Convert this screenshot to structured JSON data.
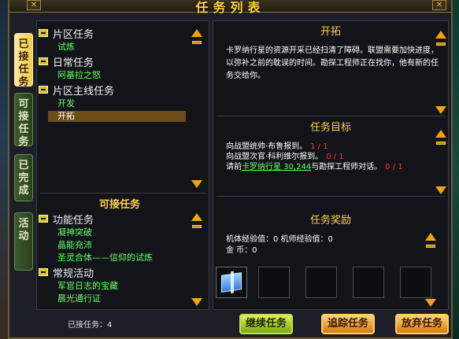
{
  "window": {
    "title": "任务列表",
    "left_button": "✕",
    "close_button": "✕"
  },
  "side_tabs": [
    {
      "label": "已接任务",
      "active": true
    },
    {
      "label": "可接任务",
      "active": false
    },
    {
      "label": "已完成",
      "active": false
    },
    {
      "label": "活动",
      "active": false
    }
  ],
  "accepted_tree": [
    {
      "head": "片区任务",
      "items": [
        "试炼"
      ]
    },
    {
      "head": "日常任务",
      "items": [
        "阿基拉之怒"
      ]
    },
    {
      "head": "片区主线任务",
      "items": [
        "开发",
        "开拓"
      ]
    }
  ],
  "selected_item": "开拓",
  "available_section": {
    "title": "可接任务",
    "groups": [
      {
        "head": "功能任务",
        "items": [
          "凝神突破",
          "晶能充沛",
          "圣灵合体——信仰的试炼"
        ]
      },
      {
        "head": "常规活动",
        "items": [
          "军官日志的宝藏",
          "晨光通行证"
        ]
      }
    ]
  },
  "detail": {
    "title": "开拓",
    "description": "卡罗纳行星的资源开采已经扫清了障碍。联盟需要加快进度，以弥补之前的耽误的时间。勘探工程师正在找你，他有新的任务交给你。",
    "goals_title": "任务目标",
    "goals": [
      {
        "prefix": "向战盟统帅·布鲁报到。",
        "link": "",
        "suffix": "",
        "progress": "1 / 1"
      },
      {
        "prefix": "向战盟次官·科利维尔报到。",
        "link": "",
        "suffix": "",
        "progress": "0 / 1"
      },
      {
        "prefix": "请前",
        "link": "卡罗纳行星 30,244",
        "suffix": "与勘探工程师对话。",
        "progress": "0 / 1"
      }
    ],
    "rewards_title": "任务奖励",
    "reward_exp": "机体经验值：0   机师经验值：0",
    "reward_coin": "金    币：0"
  },
  "footer": {
    "accepted_count_label": "已接任务：4",
    "buttons": [
      "继续任务",
      "追踪任务",
      "放弃任务"
    ]
  },
  "colors": {
    "accent_gold": "#ffd24a",
    "link_green": "#66ff66",
    "progress_red": "#ff3030",
    "scroll_orange": "#f2a210"
  }
}
